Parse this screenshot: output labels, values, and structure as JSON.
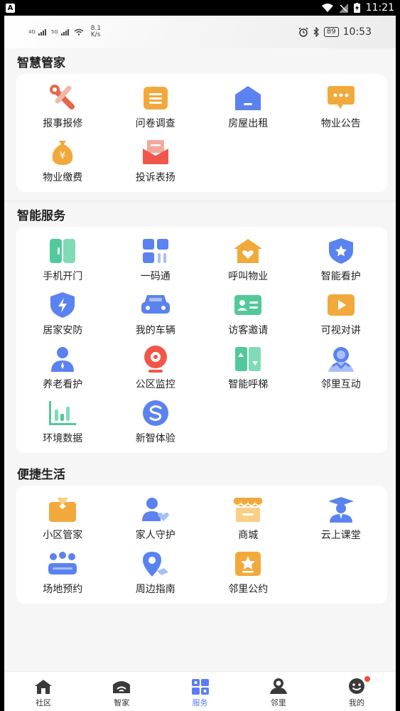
{
  "outer_status": {
    "time": "11:21",
    "app_icon_letter": "A"
  },
  "inner_status": {
    "network_1": "4G",
    "network_2": "5G",
    "speed_value": "8.1",
    "speed_unit": "K/s",
    "battery": "89",
    "time": "10:53"
  },
  "sections": [
    {
      "title": "智慧管家",
      "items": [
        "报事报修",
        "问卷调查",
        "房屋出租",
        "物业公告",
        "物业缴费",
        "投诉表扬"
      ]
    },
    {
      "title": "智能服务",
      "items": [
        "手机开门",
        "一码通",
        "呼叫物业",
        "智能看护",
        "居家安防",
        "我的车辆",
        "访客邀请",
        "可视对讲",
        "养老看护",
        "公区监控",
        "智能呼梯",
        "邻里互动",
        "环境数据",
        "新智体验"
      ]
    },
    {
      "title": "便捷生活",
      "items": [
        "小区管家",
        "家人守护",
        "商城",
        "云上课堂",
        "场地预约",
        "周边指南",
        "邻里公约"
      ]
    }
  ],
  "nav": {
    "active_index": 2,
    "items": [
      "社区",
      "智家",
      "服务",
      "邻里",
      "我的"
    ]
  },
  "colors": {
    "accent": "#5b7cf7",
    "orange": "#f2a93b",
    "green": "#52c99a",
    "red": "#f0574a",
    "blue": "#5a82f0"
  }
}
